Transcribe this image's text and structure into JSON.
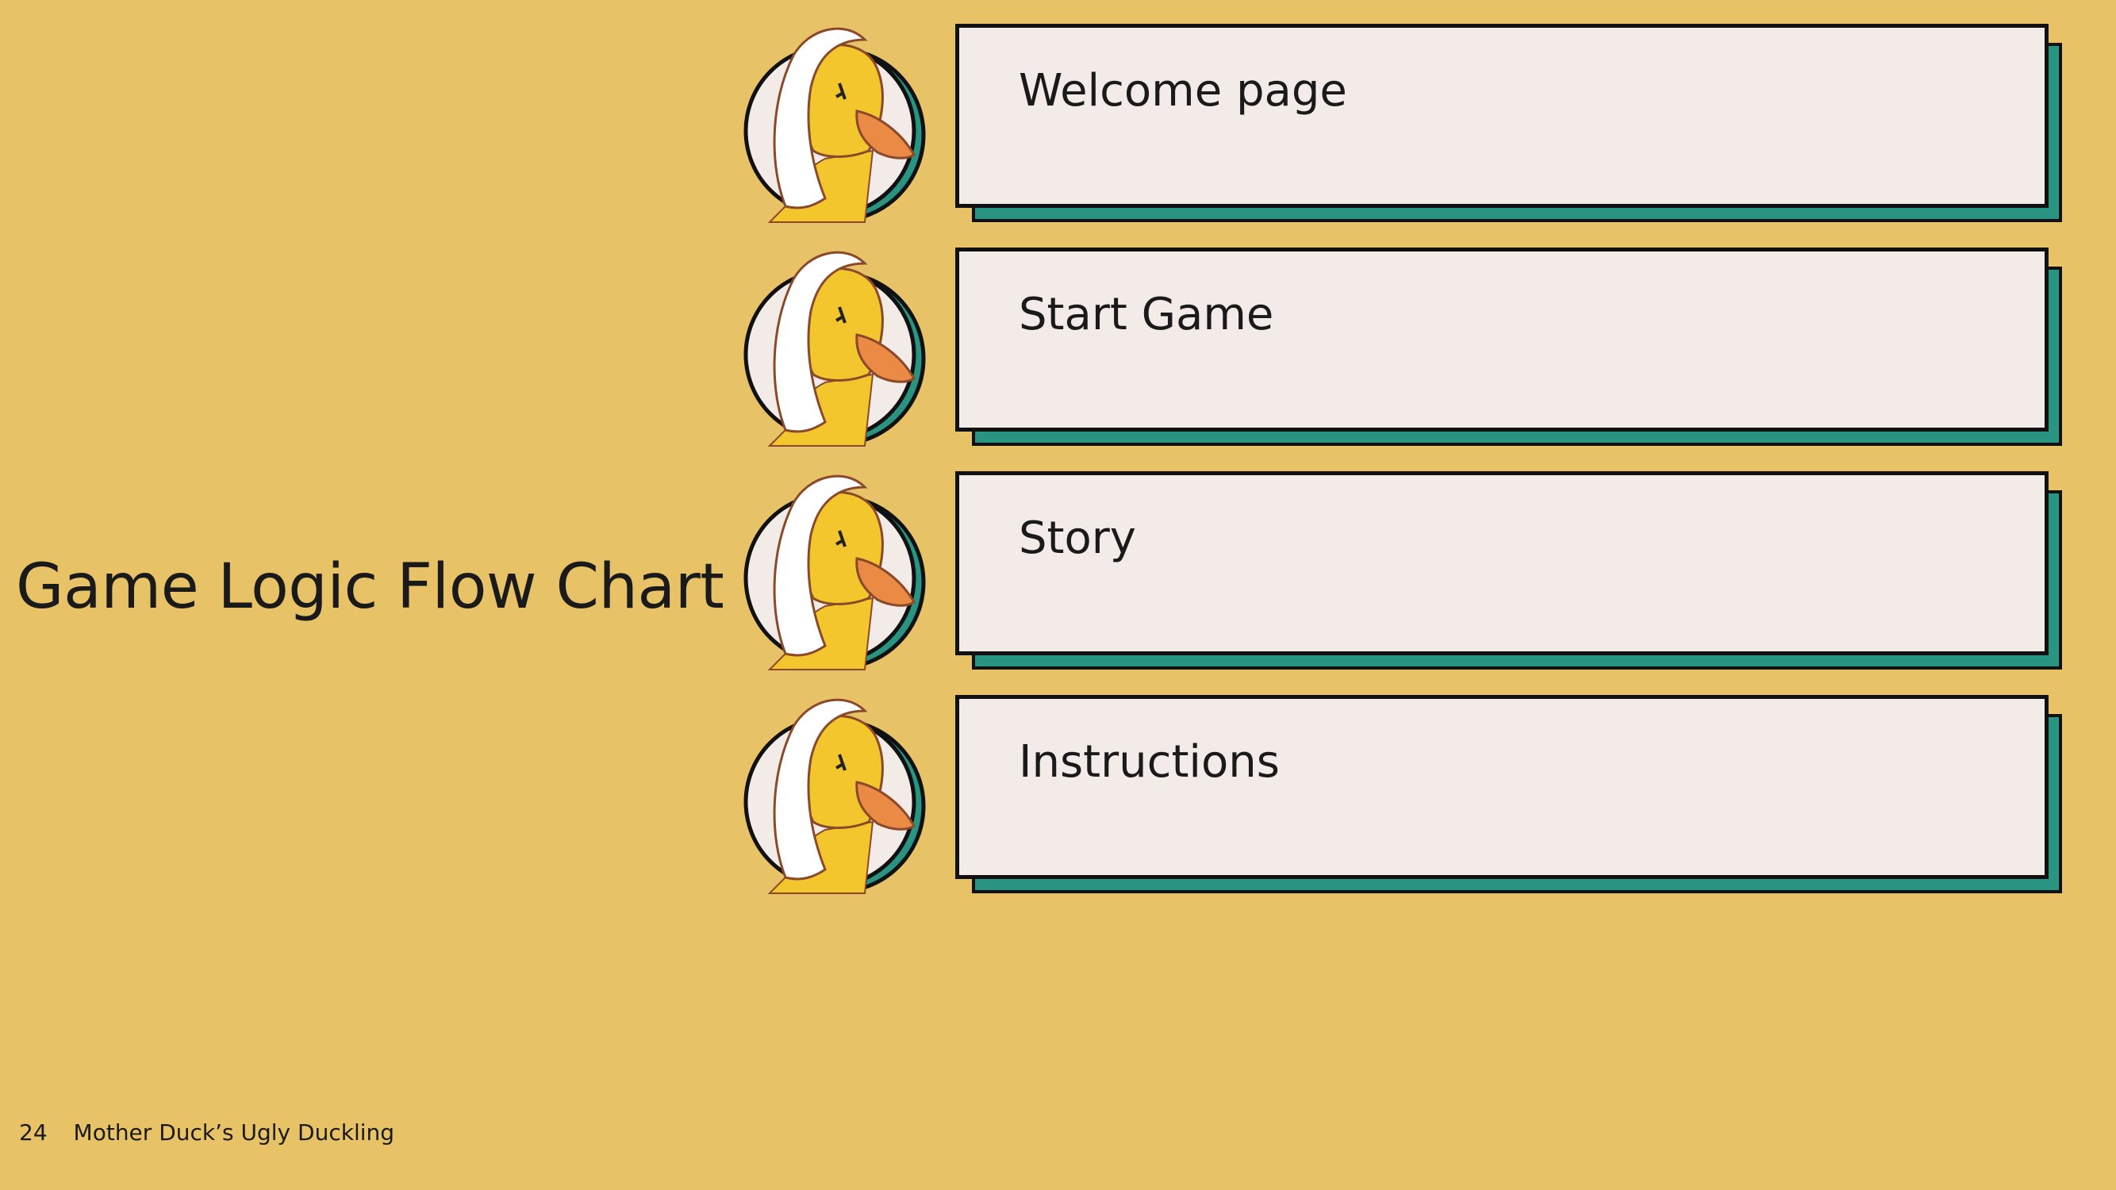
{
  "title": "Game Logic Flow Chart",
  "steps": [
    {
      "label": "Welcome page"
    },
    {
      "label": "Start Game"
    },
    {
      "label": "Story"
    },
    {
      "label": "Instructions"
    }
  ],
  "footer": {
    "page_number": "24",
    "deck_title": "Mother Duck’s Ugly Duckling"
  },
  "colors": {
    "background": "#E8C267",
    "card_fill": "#F3EBE8",
    "card_shadow": "#2A9483",
    "outline": "#111111"
  },
  "icons": {
    "step_icon": "mother-duck-headscarf-icon"
  }
}
